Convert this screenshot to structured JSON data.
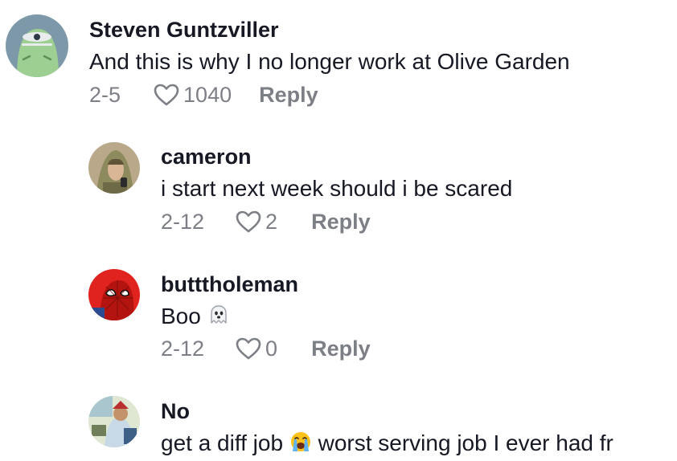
{
  "comments": [
    {
      "username": "Steven Guntzviller",
      "text": "And this is why I no longer work at Olive Garden",
      "date": "2-5",
      "likes": "1040",
      "reply_label": "Reply"
    },
    {
      "username": "cameron",
      "text": "i start next week should i be scared",
      "date": "2-12",
      "likes": "2",
      "reply_label": "Reply"
    },
    {
      "username": "butttholeman",
      "text": "Boo",
      "emoji": "ghost-emoji",
      "date": "2-12",
      "likes": "0",
      "reply_label": "Reply"
    },
    {
      "username": "No",
      "text_before": "get a diff job",
      "emoji": "loudly-crying-face-emoji",
      "text_after": "worst serving job I ever had fr"
    }
  ],
  "colors": {
    "text": "#161823",
    "secondary": "#7d7f86",
    "background": "#ffffff"
  }
}
